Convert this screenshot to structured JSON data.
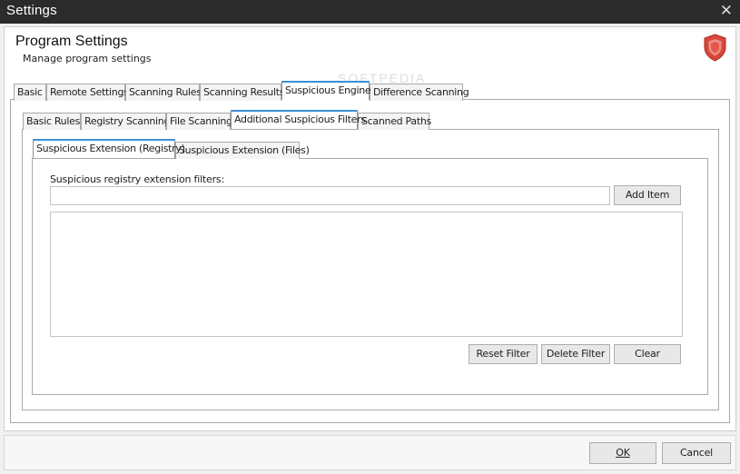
{
  "window": {
    "title": "Settings",
    "close_symbol": "✕"
  },
  "header": {
    "title": "Program Settings",
    "subtitle": "Manage program settings",
    "icon": "shield-icon"
  },
  "watermark": "SOFTPEDIA",
  "main_tabs": [
    {
      "label": "Basic"
    },
    {
      "label": "Remote Settings"
    },
    {
      "label": "Scanning Rules"
    },
    {
      "label": "Scanning Results"
    },
    {
      "label": "Suspicious Engine",
      "active": true
    },
    {
      "label": "Difference Scanning"
    }
  ],
  "sub_tabs": [
    {
      "label": "Basic Rules"
    },
    {
      "label": "Registry Scanning"
    },
    {
      "label": "File Scanning"
    },
    {
      "label": "Additional Suspicious Filters",
      "active": true
    },
    {
      "label": "Scanned Paths"
    }
  ],
  "inner_tabs": [
    {
      "label": "Suspicious Extension (Registry)",
      "active": true
    },
    {
      "label": "Suspicious Extension (Files)"
    }
  ],
  "filters": {
    "field_label": "Suspicious registry extension filters:",
    "input_value": "",
    "add_button": "Add Item",
    "reset_button": "Reset Filter",
    "delete_button": "Delete Filter",
    "clear_button": "Clear"
  },
  "footer": {
    "ok_button": "OK",
    "cancel_button": "Cancel"
  },
  "colors": {
    "titlebar": "#2b2b2b",
    "active_tab_accent": "#3b8fd9",
    "shield": "#d9463b"
  }
}
